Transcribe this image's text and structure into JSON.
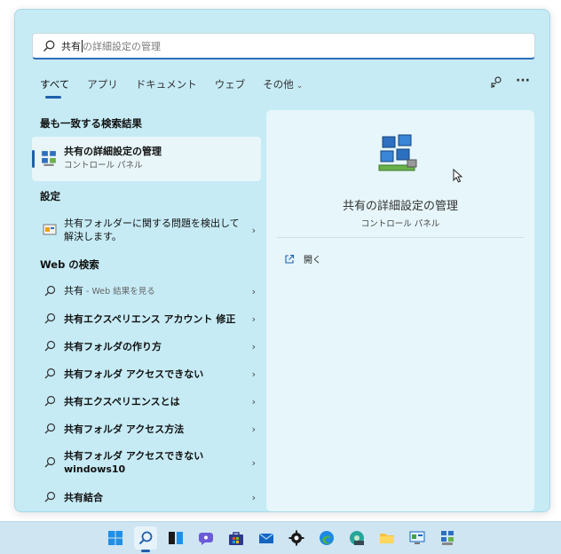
{
  "search": {
    "typed": "共有",
    "suggestion": "の詳細設定の管理"
  },
  "tabs": [
    {
      "label": "すべて"
    },
    {
      "label": "アプリ"
    },
    {
      "label": "ドキュメント"
    },
    {
      "label": "ウェブ"
    },
    {
      "label": "その他"
    }
  ],
  "best_match": {
    "heading": "最も一致する検索結果",
    "title": "共有の詳細設定の管理",
    "subtitle": "コントロール パネル"
  },
  "settings": {
    "heading": "設定",
    "item_line1": "共有フォルダーに関する問題を検出して",
    "item_line2": "解決します。"
  },
  "web": {
    "heading": "Web の検索",
    "first_term": "共有",
    "first_hint": " - Web 結果を見る",
    "items": [
      "共有エクスペリエンス アカウント 修正",
      "共有フォルダの作り方",
      "共有フォルダ アクセスできない",
      "共有エクスペリエンスとは",
      "共有フォルダ アクセス方法"
    ],
    "multi_line1": "共有フォルダ アクセスできない",
    "multi_line2": "windows10",
    "last": "共有結合"
  },
  "preview": {
    "title": "共有の詳細設定の管理",
    "subtitle": "コントロール パネル",
    "open_label": "開く"
  },
  "colors": {
    "accent": "#1f5fae",
    "panel": "#c6ebf5",
    "preview_bg": "#e6f6fa"
  }
}
